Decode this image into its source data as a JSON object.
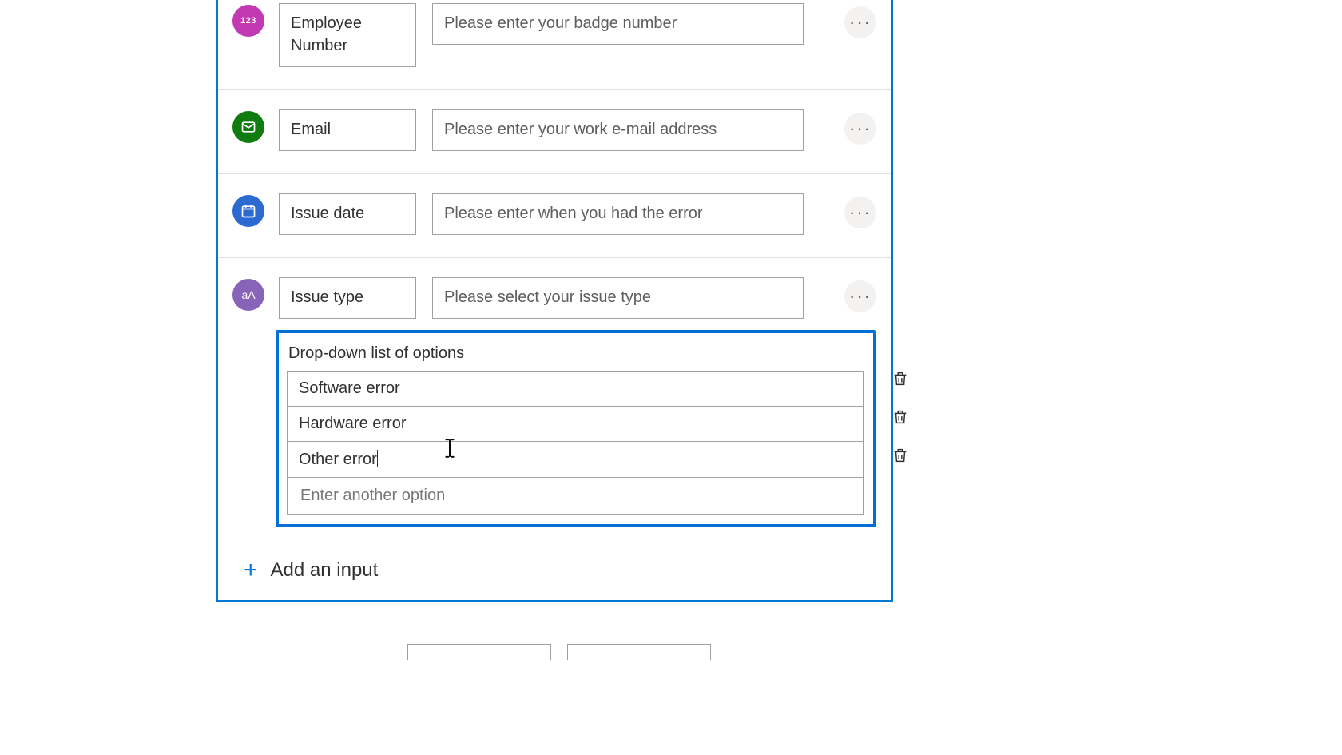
{
  "inputs": {
    "employee_number": {
      "label": "Employee Number",
      "description": "Please enter your badge number",
      "icon": "number-icon",
      "icon_text": "123",
      "icon_color": "#c239b3"
    },
    "email": {
      "label": "Email",
      "description": "Please enter your work e-mail address",
      "icon": "email-icon",
      "icon_color": "#107c10"
    },
    "issue_date": {
      "label": "Issue date",
      "description": "Please enter when you had the error",
      "icon": "calendar-icon",
      "icon_color": "#2b6ad1"
    },
    "issue_type": {
      "label": "Issue type",
      "description": "Please select your issue type",
      "icon": "text-case-icon",
      "icon_text": "aA",
      "icon_color": "#8764b8",
      "dropdown": {
        "title": "Drop-down list of options",
        "options": [
          "Software error",
          "Hardware error",
          "Other error"
        ],
        "new_option_placeholder": "Enter another option",
        "active_editing_index": 2
      }
    }
  },
  "add_input_label": "Add an input",
  "ellipsis_glyph": "···"
}
